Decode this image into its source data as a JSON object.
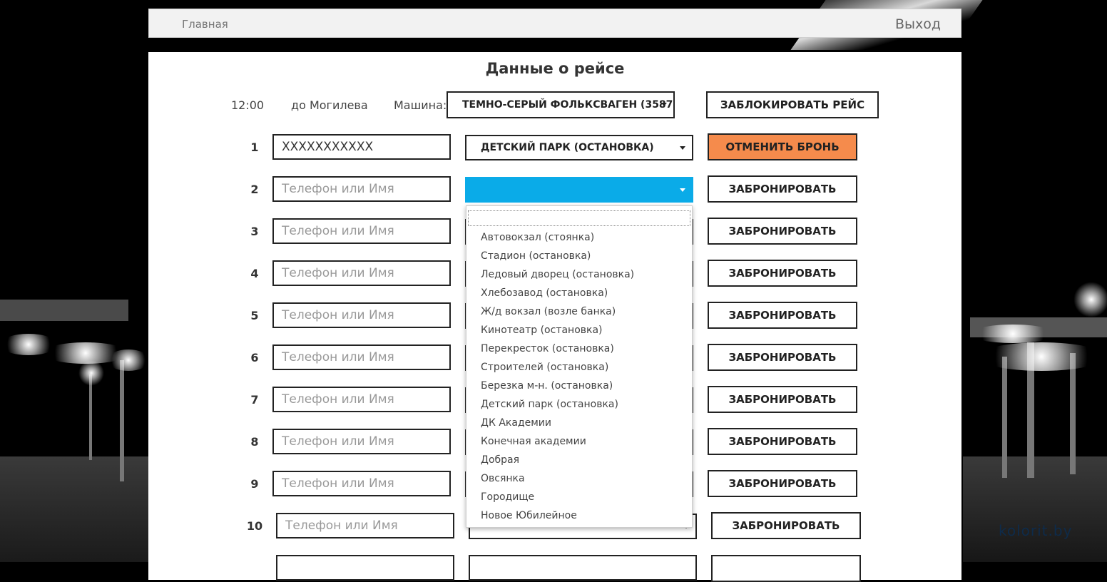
{
  "nav": {
    "home": "Главная",
    "exit": "Выход"
  },
  "trip": {
    "title": "Данные о рейсе",
    "time": "12:00",
    "destination": "до Могилева",
    "car_label": "Машина:",
    "car_value": "ТЕМНО-СЕРЫЙ ФОЛЬКСВАГЕН (3587",
    "block_button": "ЗАБЛОКИРОВАТЬ РЕЙС"
  },
  "seats": [
    {
      "num": "1",
      "value": "XXXXXXXXXXX",
      "placeholder": "",
      "stop": "ДЕТСКИЙ ПАРК (ОСТАНОВКА)",
      "action": "ОТМЕНИТЬ БРОНЬ"
    },
    {
      "num": "2",
      "value": "",
      "placeholder": "Телефон или Имя",
      "stop": "",
      "action": "ЗАБРОНИРОВАТЬ"
    },
    {
      "num": "3",
      "value": "",
      "placeholder": "Телефон или Имя",
      "stop": "",
      "action": "ЗАБРОНИРОВАТЬ"
    },
    {
      "num": "4",
      "value": "",
      "placeholder": "Телефон или Имя",
      "stop": "",
      "action": "ЗАБРОНИРОВАТЬ"
    },
    {
      "num": "5",
      "value": "",
      "placeholder": "Телефон или Имя",
      "stop": "",
      "action": "ЗАБРОНИРОВАТЬ"
    },
    {
      "num": "6",
      "value": "",
      "placeholder": "Телефон или Имя",
      "stop": "",
      "action": "ЗАБРОНИРОВАТЬ"
    },
    {
      "num": "7",
      "value": "",
      "placeholder": "Телефон или Имя",
      "stop": "",
      "action": "ЗАБРОНИРОВАТЬ"
    },
    {
      "num": "8",
      "value": "",
      "placeholder": "Телефон или Имя",
      "stop": "",
      "action": "ЗАБРОНИРОВАТЬ"
    },
    {
      "num": "9",
      "value": "",
      "placeholder": "Телефон или Имя",
      "stop": "",
      "action": "ЗАБРОНИРОВАТЬ"
    },
    {
      "num": "10",
      "value": "",
      "placeholder": "Телефон или Имя",
      "stop": "",
      "action": "ЗАБРОНИРОВАТЬ"
    }
  ],
  "dropdown": {
    "options": [
      "Автовокзал (стоянка)",
      "Стадион (остановка)",
      "Ледовый дворец (остановка)",
      "Хлебозавод (остановка)",
      "Ж/д вокзал (возле банка)",
      "Кинотеатр (остановка)",
      "Перекресток (остановка)",
      "Строителей (остановка)",
      "Березка м-н. (остановка)",
      "Детский парк (остановка)",
      "ДК Академии",
      "Конечная академии",
      "Добрая",
      "Овсянка",
      "Городище",
      "Новое Юбилейное"
    ]
  },
  "colors": {
    "accent_open_select": "#0aabe8",
    "cancel_button": "#f58b4c"
  }
}
